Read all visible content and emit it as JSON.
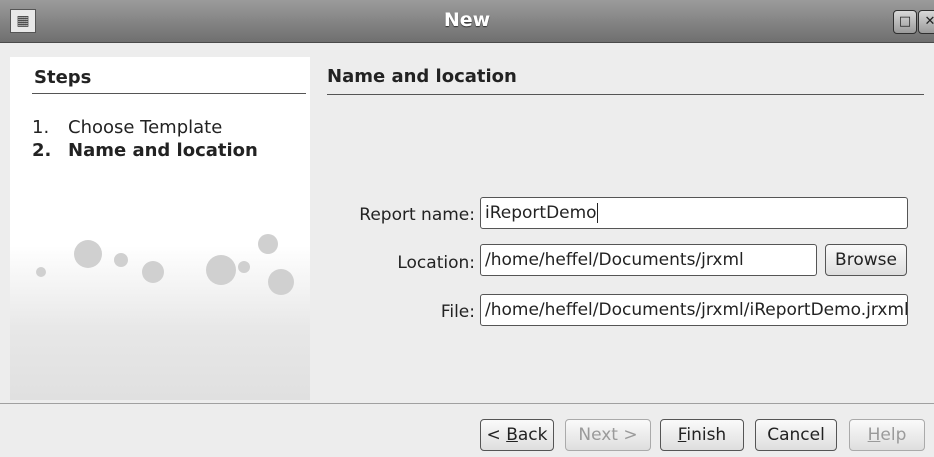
{
  "window": {
    "title": "New"
  },
  "steps": {
    "heading": "Steps",
    "items": [
      {
        "num": "1.",
        "label": "Choose Template"
      },
      {
        "num": "2.",
        "label": "Name and location"
      }
    ]
  },
  "main": {
    "section_title": "Name and location",
    "report_name": {
      "label": "Report name:",
      "value": "iReportDemo"
    },
    "location": {
      "label": "Location:",
      "value": "/home/heffel/Documents/jrxml",
      "browse_label": "Browse"
    },
    "file": {
      "label": "File:",
      "value": "/home/heffel/Documents/jrxml/iReportDemo.jrxml"
    }
  },
  "buttons": {
    "back": {
      "prefix": "< ",
      "mnemonic": "B",
      "rest": "ack"
    },
    "next": {
      "label": "Next >"
    },
    "finish": {
      "mnemonic": "F",
      "rest": "inish"
    },
    "cancel": {
      "label": "Cancel"
    },
    "help": {
      "mnemonic": "H",
      "rest": "elp"
    }
  }
}
